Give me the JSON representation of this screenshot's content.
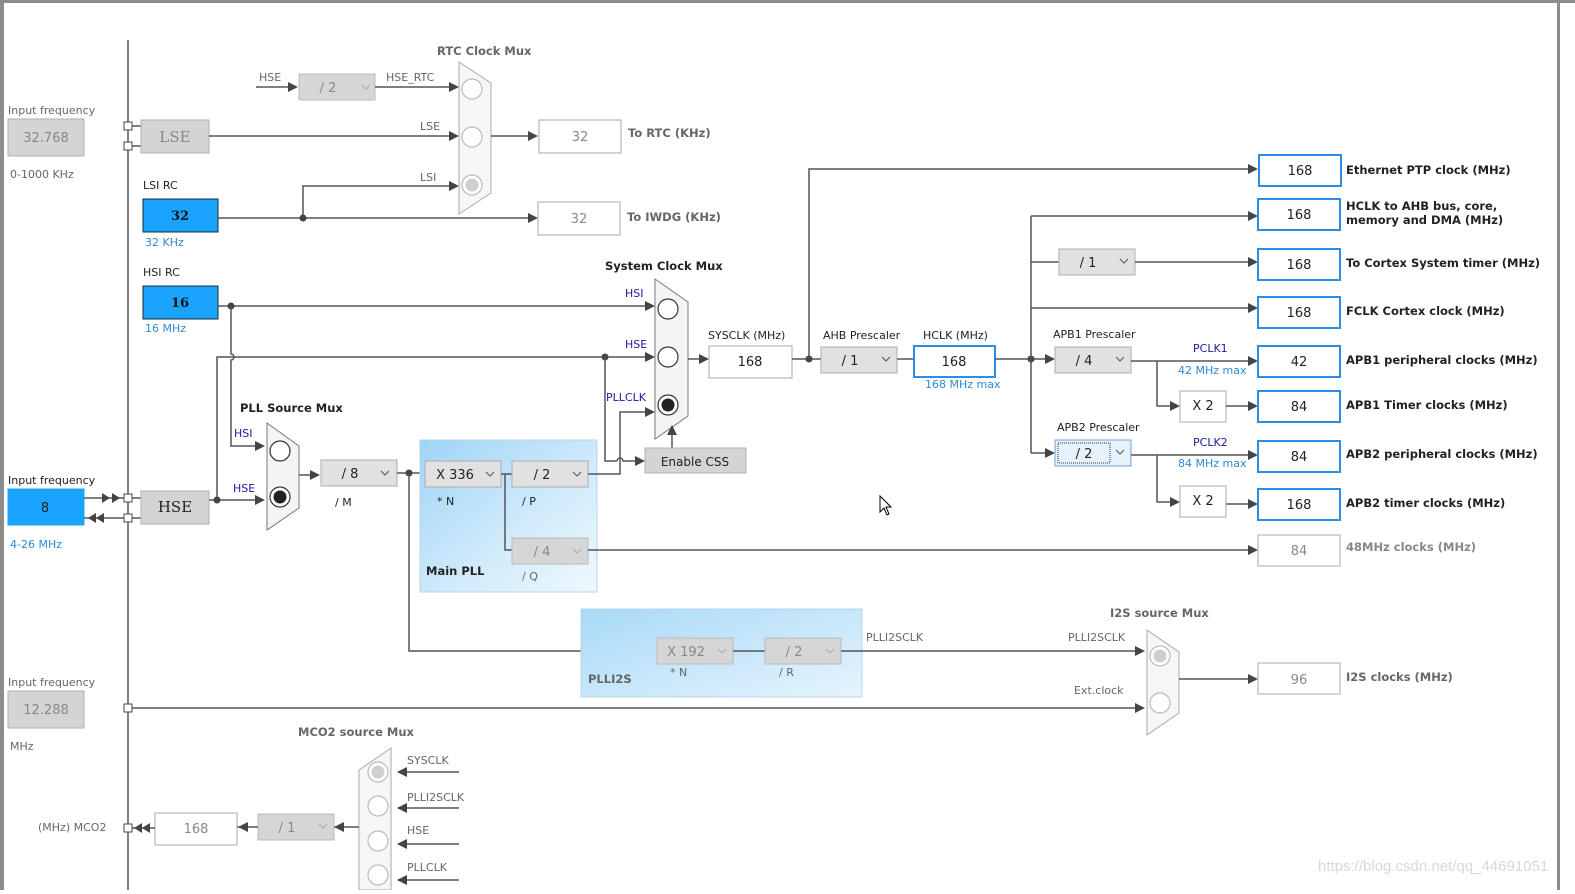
{
  "left_inputs": {
    "lse_input": {
      "label": "Input frequency",
      "value": "32.768",
      "range": "0-1000 KHz"
    },
    "hse_input": {
      "label": "Input frequency",
      "value": "8",
      "range": "4-26 MHz"
    },
    "ext_input": {
      "label": "Input frequency",
      "value": "12.288",
      "range": "MHz"
    },
    "mco2_label": "(MHz) MCO2"
  },
  "sources": {
    "lse": "LSE",
    "hse": "HSE",
    "lsi_rc": {
      "title": "LSI RC",
      "value": "32",
      "hint": "32 KHz"
    },
    "hsi_rc": {
      "title": "HSI RC",
      "value": "16",
      "hint": "16 MHz"
    }
  },
  "rtc": {
    "title": "RTC Clock Mux",
    "hse_label": "HSE",
    "hse_div": "/ 2",
    "hse_rtc_label": "HSE_RTC",
    "lse_label": "LSE",
    "lsi_label": "LSI",
    "selected": "LSI",
    "to_rtc_value": "32",
    "to_rtc_label": "To RTC (KHz)",
    "to_iwdg_value": "32",
    "to_iwdg_label": "To IWDG (KHz)"
  },
  "pll_source_mux": {
    "title": "PLL Source Mux",
    "inputs": [
      "HSI",
      "HSE"
    ],
    "selected": "HSE"
  },
  "main_pll": {
    "title": "Main PLL",
    "m_div": "/ 8",
    "m_label": "/ M",
    "n_mul": "X 336",
    "n_label": "* N",
    "p_div": "/ 2",
    "p_label": "/ P",
    "q_div": "/ 4",
    "q_label": "/ Q"
  },
  "system_clock_mux": {
    "title": "System Clock Mux",
    "inputs": [
      "HSI",
      "HSE",
      "PLLCLK"
    ],
    "selected": "PLLCLK",
    "enable_css": "Enable CSS"
  },
  "sysclk": {
    "label": "SYSCLK (MHz)",
    "value": "168"
  },
  "ahb": {
    "label": "AHB Prescaler",
    "value": "/ 1"
  },
  "hclk": {
    "label": "HCLK (MHz)",
    "value": "168",
    "hint": "168 MHz max"
  },
  "cortex_div": "/ 1",
  "apb1": {
    "label": "APB1 Prescaler",
    "value": "/ 4",
    "pclk": "PCLK1",
    "hint": "42 MHz max",
    "timer_mul": "X 2"
  },
  "apb2": {
    "label": "APB2 Prescaler",
    "value": "/ 2",
    "pclk": "PCLK2",
    "hint": "84 MHz max",
    "timer_mul": "X 2"
  },
  "outputs": [
    {
      "value": "168",
      "label": "Ethernet PTP clock (MHz)"
    },
    {
      "value": "168",
      "label": "HCLK to AHB bus, core,",
      "label2": "memory and DMA (MHz)"
    },
    {
      "value": "168",
      "label": "To Cortex System timer (MHz)"
    },
    {
      "value": "168",
      "label": "FCLK Cortex clock (MHz)"
    },
    {
      "value": "42",
      "label": "APB1 peripheral clocks (MHz)"
    },
    {
      "value": "84",
      "label": "APB1 Timer clocks (MHz)"
    },
    {
      "value": "84",
      "label": "APB2 peripheral clocks (MHz)"
    },
    {
      "value": "168",
      "label": "APB2 timer clocks (MHz)"
    },
    {
      "value": "84",
      "label": "48MHz clocks (MHz)"
    }
  ],
  "plli2s": {
    "title": "PLLI2S",
    "n_mul": "X 192",
    "n_label": "* N",
    "r_div": "/ 2",
    "r_label": "/ R",
    "out_label": "PLLI2SCLK"
  },
  "i2s_mux": {
    "title": "I2S source Mux",
    "inputs": [
      "PLLI2SCLK",
      "Ext.clock"
    ],
    "selected": "PLLI2SCLK",
    "out_value": "96",
    "out_label": "I2S clocks (MHz)"
  },
  "mco2": {
    "title": "MCO2 source Mux",
    "inputs": [
      "SYSCLK",
      "PLLI2SCLK",
      "HSE",
      "PLLCLK"
    ],
    "selected": "SYSCLK",
    "div": "/ 1",
    "value": "168"
  },
  "watermark": "https://blog.csdn.net/qq_44691051"
}
